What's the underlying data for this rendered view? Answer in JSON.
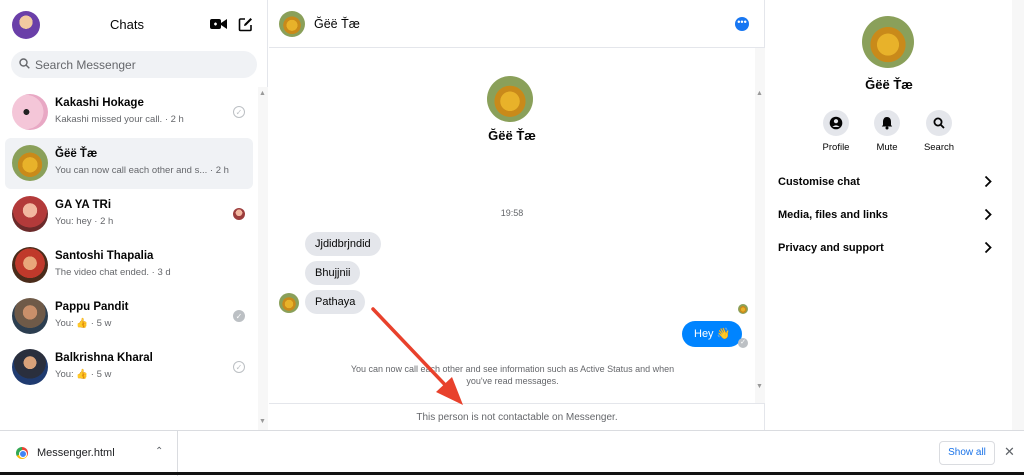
{
  "left": {
    "title": "Chats",
    "search_placeholder": "Search Messenger",
    "conversations": [
      {
        "name": "Kakashi Hokage",
        "preview": "Kakashi missed your call. · 2 h"
      },
      {
        "name": "Ğëë Ťæ",
        "preview": "You can now call each other and s... · 2 h"
      },
      {
        "name": "GA YA TRi",
        "preview": "You: hey · 2 h"
      },
      {
        "name": "Santoshi Thapalia",
        "preview": "The video chat ended. · 3 d"
      },
      {
        "name": "Pappu Pandit",
        "preview": "You: 👍 · 5 w"
      },
      {
        "name": "Balkrishna Kharal",
        "preview": "You: 👍 · 5 w"
      }
    ]
  },
  "chat": {
    "name": "Ğëë Ťæ",
    "timestamp": "19:58",
    "incoming": [
      "Jjdidbrjndid",
      "Bhujjnii",
      "Pathaya"
    ],
    "outgoing": "Hey 👋",
    "info": "You can now call each other and see information such as Active Status and when you've read messages.",
    "footer": "This person is not contactable on Messenger."
  },
  "right": {
    "name": "Ğëë Ťæ",
    "actions": [
      "Profile",
      "Mute",
      "Search"
    ],
    "menu": [
      "Customise chat",
      "Media, files and links",
      "Privacy and support"
    ]
  },
  "downloads": {
    "file": "Messenger.html",
    "show_all": "Show all"
  },
  "colors": {
    "accent": "#0084ff",
    "annotation_arrow": "#e8412c"
  }
}
